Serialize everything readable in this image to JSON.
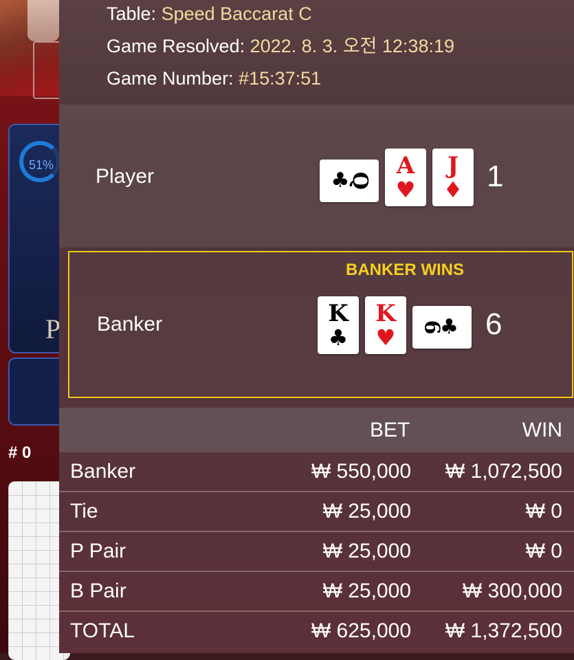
{
  "background": {
    "percent": "51%",
    "letter": "P",
    "count": "# 0"
  },
  "info": {
    "table_label": "Table:",
    "table_value": "Speed Baccarat C",
    "resolved_label": "Game Resolved:",
    "resolved_value": "2022. 8. 3. 오전 12:38:19",
    "number_label": "Game Number:",
    "number_value": "#15:37:51"
  },
  "player": {
    "label": "Player",
    "score": "1",
    "cards": [
      {
        "rank": "Q",
        "suit": "♣",
        "color": "#000000",
        "orientation": "sideways"
      },
      {
        "rank": "A",
        "suit": "♥",
        "color": "#e0161e",
        "orientation": "upright"
      },
      {
        "rank": "J",
        "suit": "♦",
        "color": "#e0161e",
        "orientation": "upright"
      }
    ]
  },
  "banker": {
    "label": "Banker",
    "result": "BANKER WINS",
    "score": "6",
    "cards": [
      {
        "rank": "K",
        "suit": "♣",
        "color": "#000000",
        "orientation": "upright"
      },
      {
        "rank": "K",
        "suit": "♥",
        "color": "#e0161e",
        "orientation": "upright"
      },
      {
        "rank": "6",
        "suit": "♣",
        "color": "#000000",
        "orientation": "sideways"
      }
    ]
  },
  "bets": {
    "header_bet": "BET",
    "header_win": "WIN",
    "rows": [
      {
        "name": "Banker",
        "bet": "₩ 550,000",
        "win": "₩ 1,072,500"
      },
      {
        "name": "Tie",
        "bet": "₩ 25,000",
        "win": "₩ 0"
      },
      {
        "name": "P Pair",
        "bet": "₩ 25,000",
        "win": "₩ 0"
      },
      {
        "name": "B Pair",
        "bet": "₩ 25,000",
        "win": "₩ 300,000"
      },
      {
        "name": "TOTAL",
        "bet": "₩ 625,000",
        "win": "₩ 1,372,500"
      }
    ]
  },
  "colors": {
    "accent": "#f3d9a0",
    "win_highlight": "#f7cf20",
    "red_suit": "#e0161e"
  }
}
